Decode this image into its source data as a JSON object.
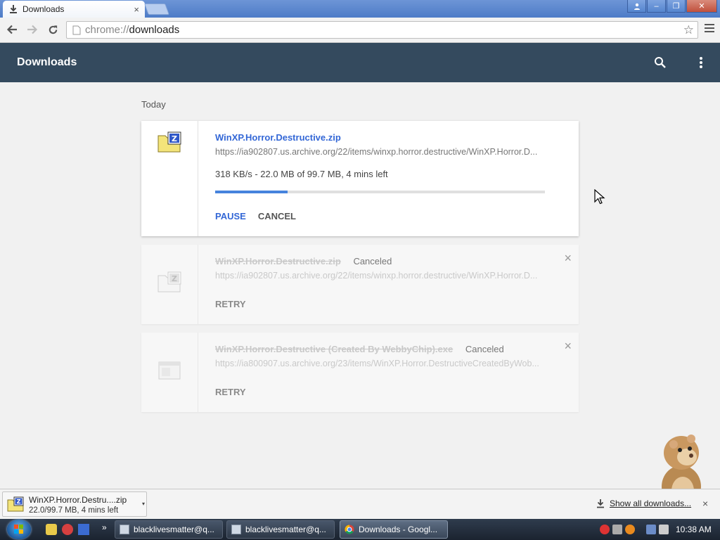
{
  "browser": {
    "tab_title": "Downloads",
    "tab_close": "×",
    "window_controls": {
      "minimize": "–",
      "restore": "❐",
      "close": "✕"
    },
    "address_scheme": "chrome://",
    "address_host": "downloads"
  },
  "header": {
    "title": "Downloads"
  },
  "list": {
    "date_label": "Today",
    "items": [
      {
        "file_name": "WinXP.Horror.Destructive.zip",
        "url": "https://ia902807.us.archive.org/22/items/winxp.horror.destructive/WinXP.Horror.D...",
        "progress_text": "318 KB/s - 22.0 MB of 99.7 MB, 4 mins left",
        "progress_percent": 22,
        "pause_label": "PAUSE",
        "cancel_label": "CANCEL"
      },
      {
        "file_name": "WinXP.Horror.Destructive.zip",
        "status": "Canceled",
        "url": "https://ia902807.us.archive.org/22/items/winxp.horror.destructive/WinXP.Horror.D...",
        "retry_label": "RETRY",
        "remove_icon": "×"
      },
      {
        "file_name": "WinXP.Horror.Destructive (Created By WebbyChip).exe",
        "status": "Canceled",
        "url": "https://ia800907.us.archive.org/23/items/WinXP.Horror.DestructiveCreatedByWob...",
        "retry_label": "RETRY",
        "remove_icon": "×"
      }
    ]
  },
  "shelf": {
    "item_name": "WinXP.Horror.Destru....zip",
    "item_status": "22.0/99.7 MB, 4 mins left",
    "dropdown": "▾",
    "show_all": "Show all downloads...",
    "close": "×"
  },
  "taskbar": {
    "more": "»",
    "tasks": [
      {
        "label": "blacklivesmatter@q..."
      },
      {
        "label": "blacklivesmatter@q..."
      },
      {
        "label": "Downloads - Googl..."
      }
    ],
    "clock": "10:38 AM"
  },
  "colors": {
    "header_bg": "#344a5e",
    "link_blue": "#3367d6",
    "progress_blue": "#4683dd"
  }
}
